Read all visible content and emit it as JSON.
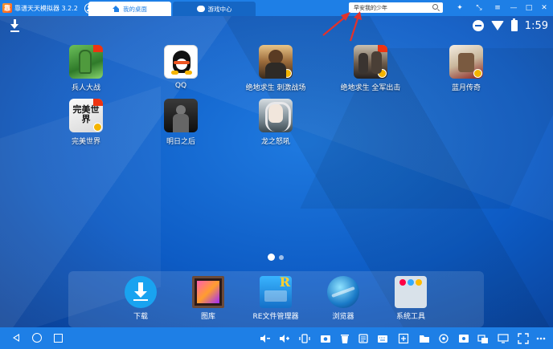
{
  "window": {
    "title": "靠谱天天模拟器 3.2.2",
    "tabs": [
      {
        "label": "我的桌面",
        "active": true
      },
      {
        "label": "游戏中心",
        "active": false
      }
    ],
    "search": {
      "value": "早安我的少年"
    }
  },
  "status": {
    "time": "1:59"
  },
  "apps": [
    {
      "label": "兵人大战",
      "icon": "soldier-icon"
    },
    {
      "label": "QQ",
      "icon": "qq-icon"
    },
    {
      "label": "绝地求生 刺激战场",
      "icon": "pubg-icon"
    },
    {
      "label": "绝地求生 全军出击",
      "icon": "pubg-icon"
    },
    {
      "label": "蓝月传奇",
      "icon": "legend-icon"
    },
    {
      "label": "完美世界",
      "icon": "world-icon"
    },
    {
      "label": "明日之后",
      "icon": "dawn-icon"
    },
    {
      "label": "龙之怒吼",
      "icon": "dragon-icon"
    }
  ],
  "world_icon_text": "完美世界",
  "dock": [
    {
      "label": "下载",
      "icon": "download-icon"
    },
    {
      "label": "图库",
      "icon": "gallery-icon"
    },
    {
      "label": "RE文件管理器",
      "icon": "re-file-manager-icon"
    },
    {
      "label": "浏览器",
      "icon": "browser-icon"
    },
    {
      "label": "系统工具",
      "icon": "system-tools-icon"
    }
  ],
  "pager": {
    "pages": 2,
    "current": 1
  },
  "colors": {
    "titlebar": "#1e7fe6",
    "desktop": "#0d5bc4",
    "arrow": "#e2322b"
  }
}
